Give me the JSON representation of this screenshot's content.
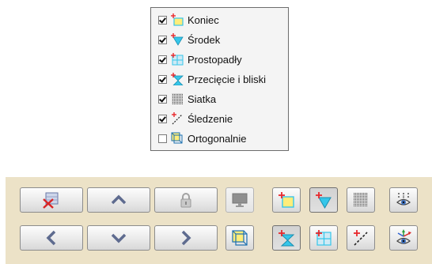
{
  "snap_menu": {
    "items": [
      {
        "label": "Koniec",
        "checked": true,
        "icon": "endpoint-icon"
      },
      {
        "label": "Środek",
        "checked": true,
        "icon": "midpoint-icon"
      },
      {
        "label": "Prostopadły",
        "checked": true,
        "icon": "perpendicular-icon"
      },
      {
        "label": "Przecięcie i bliski",
        "checked": true,
        "icon": "intersection-icon"
      },
      {
        "label": "Siatka",
        "checked": true,
        "icon": "grid-icon"
      },
      {
        "label": "Śledzenie",
        "checked": true,
        "icon": "tracking-icon"
      },
      {
        "label": "Ortogonalnie",
        "checked": false,
        "icon": "ortho-icon"
      }
    ]
  },
  "toolbar": {
    "buttons": [
      {
        "icon": "clear-constraints-icon"
      },
      {
        "icon": "arrow-up-icon"
      },
      {
        "icon": "lock-icon"
      },
      {
        "icon": "monitor-icon"
      },
      {
        "icon": "snap-endpoint-icon"
      },
      {
        "icon": "snap-midpoint-icon"
      },
      {
        "icon": "snap-grid-icon"
      },
      {
        "icon": "view-working-plane-icon"
      },
      {
        "icon": "arrow-left-icon"
      },
      {
        "icon": "arrow-down-icon"
      },
      {
        "icon": "arrow-right-icon"
      },
      {
        "icon": "snap-ortho-icon"
      },
      {
        "icon": "snap-intersection-icon"
      },
      {
        "icon": "snap-perpendicular-icon"
      },
      {
        "icon": "snap-tracking-icon"
      },
      {
        "icon": "view-axes-icon"
      }
    ]
  },
  "colors": {
    "toolbar_bg": "#ece2c7",
    "menu_bg": "#f4f4f4",
    "snap_yellow": "#ffed7a",
    "snap_cyan": "#35c6ea",
    "marker_red": "#e8282c"
  }
}
